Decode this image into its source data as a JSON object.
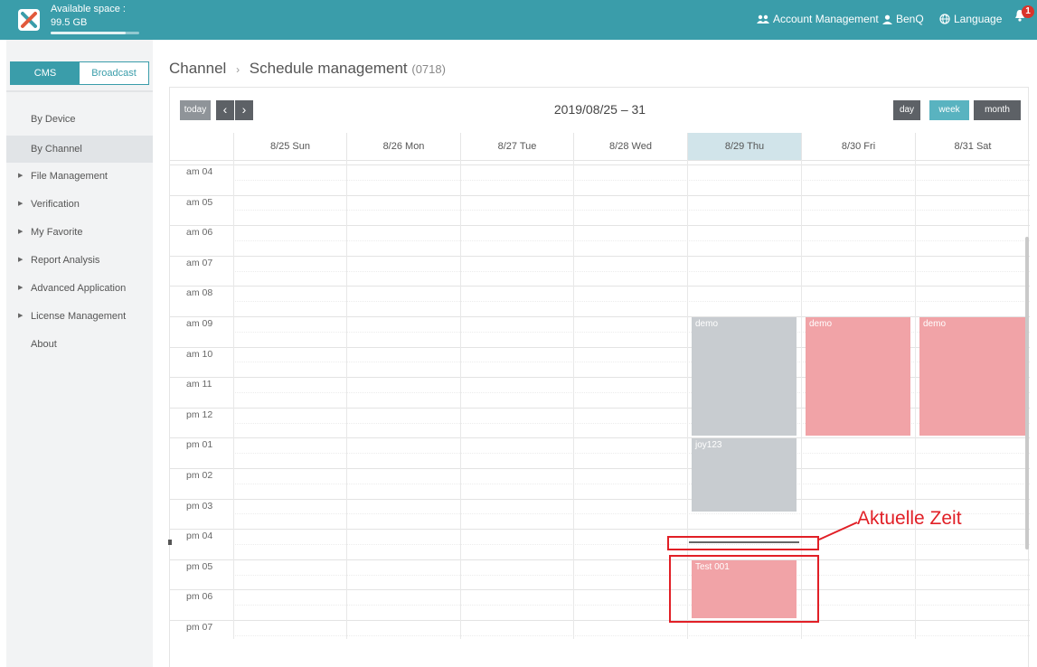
{
  "topbar": {
    "space_label": "Available space :",
    "space_value": "99.5 GB",
    "space_used_fraction": 0.85,
    "account_management": "Account Management",
    "user": "BenQ",
    "language": "Language",
    "notification_count": "1"
  },
  "sidebar": {
    "tabs": [
      "CMS",
      "Broadcast"
    ],
    "items": [
      {
        "label": "By Device",
        "caret": false
      },
      {
        "label": "By Channel",
        "caret": false,
        "selected": true
      },
      {
        "label": "File Management",
        "caret": true
      },
      {
        "label": "Verification",
        "caret": true
      },
      {
        "label": "My Favorite",
        "caret": true
      },
      {
        "label": "Report Analysis",
        "caret": true
      },
      {
        "label": "Advanced Application",
        "caret": true
      },
      {
        "label": "License Management",
        "caret": true
      },
      {
        "label": "About",
        "caret": false
      }
    ]
  },
  "breadcrumb": {
    "parent": "Channel",
    "separator": "›",
    "current": "Schedule management",
    "code": "(0718)"
  },
  "calendar": {
    "today_label": "today",
    "prev_icon": "‹",
    "next_icon": "›",
    "title": "2019/08/25 – 31",
    "views": [
      "day",
      "week",
      "month"
    ],
    "active_view": "week",
    "days": [
      "8/25 Sun",
      "8/26 Mon",
      "8/27 Tue",
      "8/28 Wed",
      "8/29 Thu",
      "8/30 Fri",
      "8/31 Sat"
    ],
    "today_index": 4,
    "hours": [
      "am 04",
      "am 05",
      "am 06",
      "am 07",
      "am 08",
      "am 09",
      "am 10",
      "am 11",
      "pm 12",
      "pm 01",
      "pm 02",
      "pm 03",
      "pm 04",
      "pm 05",
      "pm 06",
      "pm 07"
    ],
    "events": [
      {
        "title": "demo",
        "day": 4,
        "start": 9,
        "end": 13,
        "color": "grey"
      },
      {
        "title": "demo",
        "day": 5,
        "start": 9,
        "end": 13,
        "color": "pink"
      },
      {
        "title": "demo",
        "day": 6,
        "start": 9,
        "end": 13,
        "color": "pink"
      },
      {
        "title": "joy123",
        "day": 4,
        "start": 13,
        "end": 15.5,
        "color": "grey"
      },
      {
        "title": "Test 001",
        "day": 4,
        "start": 17,
        "end": 19,
        "color": "pink"
      }
    ],
    "now_hour": 16.4
  },
  "annotation": {
    "label": "Aktuelle Zeit"
  },
  "colors": {
    "brand": "#3a9daa",
    "event_grey": "#c8ccd0",
    "event_pink": "#f1a3a7",
    "today_col": "#d1e4ea",
    "annotation_red": "#e11f26"
  }
}
